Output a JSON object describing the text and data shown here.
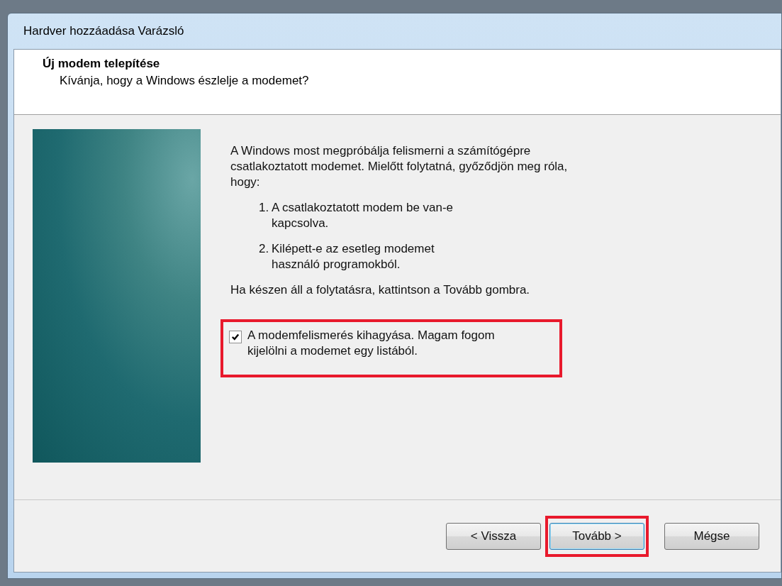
{
  "window": {
    "title": "Hardver hozzáadása Varázsló"
  },
  "header": {
    "title": "Új modem telepítése",
    "subtitle": "Kívánja, hogy a Windows észlelje a modemet?"
  },
  "body": {
    "intro": "A Windows most megpróbálja felismerni a számítógépre csatlakoztatott modemet. Mielőtt folytatná, győződjön meg róla, hogy:",
    "steps": [
      {
        "number": "1.",
        "text": "A csatlakoztatott modem be van-e kapcsolva."
      },
      {
        "number": "2.",
        "text": "Kilépett-e az esetleg modemet használó programokból."
      }
    ],
    "instruction": "Ha készen áll a folytatásra, kattintson a Tovább gombra.",
    "option": {
      "label": "A modemfelismerés kihagyása. Magam fogom kijelölni a modemet egy listából.",
      "checked": true,
      "highlighted": true
    }
  },
  "buttons": [
    {
      "label": "< Vissza",
      "default": false,
      "highlighted": false
    },
    {
      "label": "Tovább >",
      "default": true,
      "highlighted": true
    },
    {
      "label": "Mégse",
      "default": false,
      "highlighted": false
    }
  ]
}
